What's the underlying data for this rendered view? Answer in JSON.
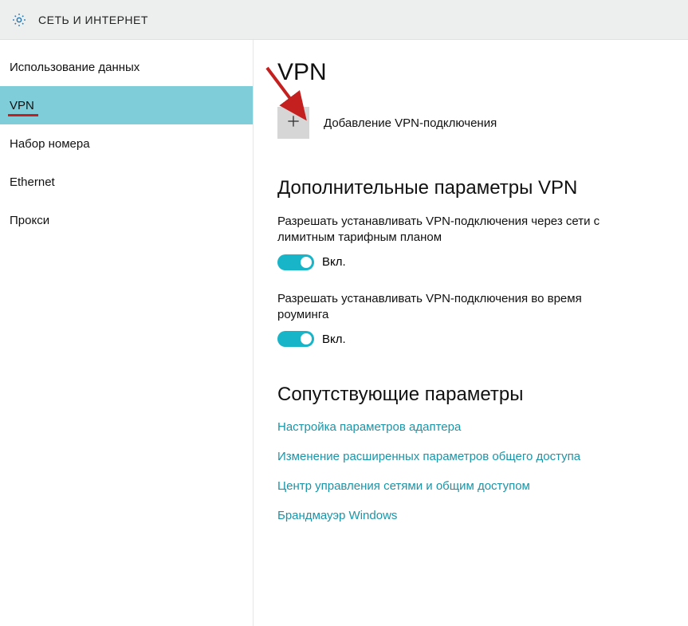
{
  "header": {
    "title": "СЕТЬ И ИНТЕРНЕТ"
  },
  "sidebar": {
    "items": [
      {
        "label": "Использование данных",
        "selected": false
      },
      {
        "label": "VPN",
        "selected": true
      },
      {
        "label": "Набор номера",
        "selected": false
      },
      {
        "label": "Ethernet",
        "selected": false
      },
      {
        "label": "Прокси",
        "selected": false
      }
    ]
  },
  "main": {
    "title": "VPN",
    "add_vpn_label": "Добавление VPN-подключения",
    "advanced_title": "Дополнительные параметры VPN",
    "settings": [
      {
        "desc": "Разрешать устанавливать VPN-подключения через сети с лимитным тарифным планом",
        "state_label": "Вкл."
      },
      {
        "desc": "Разрешать устанавливать VPN-подключения во время роуминга",
        "state_label": "Вкл."
      }
    ],
    "related_title": "Сопутствующие параметры",
    "related_links": [
      "Настройка параметров адаптера",
      "Изменение расширенных параметров общего доступа",
      "Центр управления сетями и общим доступом",
      "Брандмауэр Windows"
    ]
  }
}
